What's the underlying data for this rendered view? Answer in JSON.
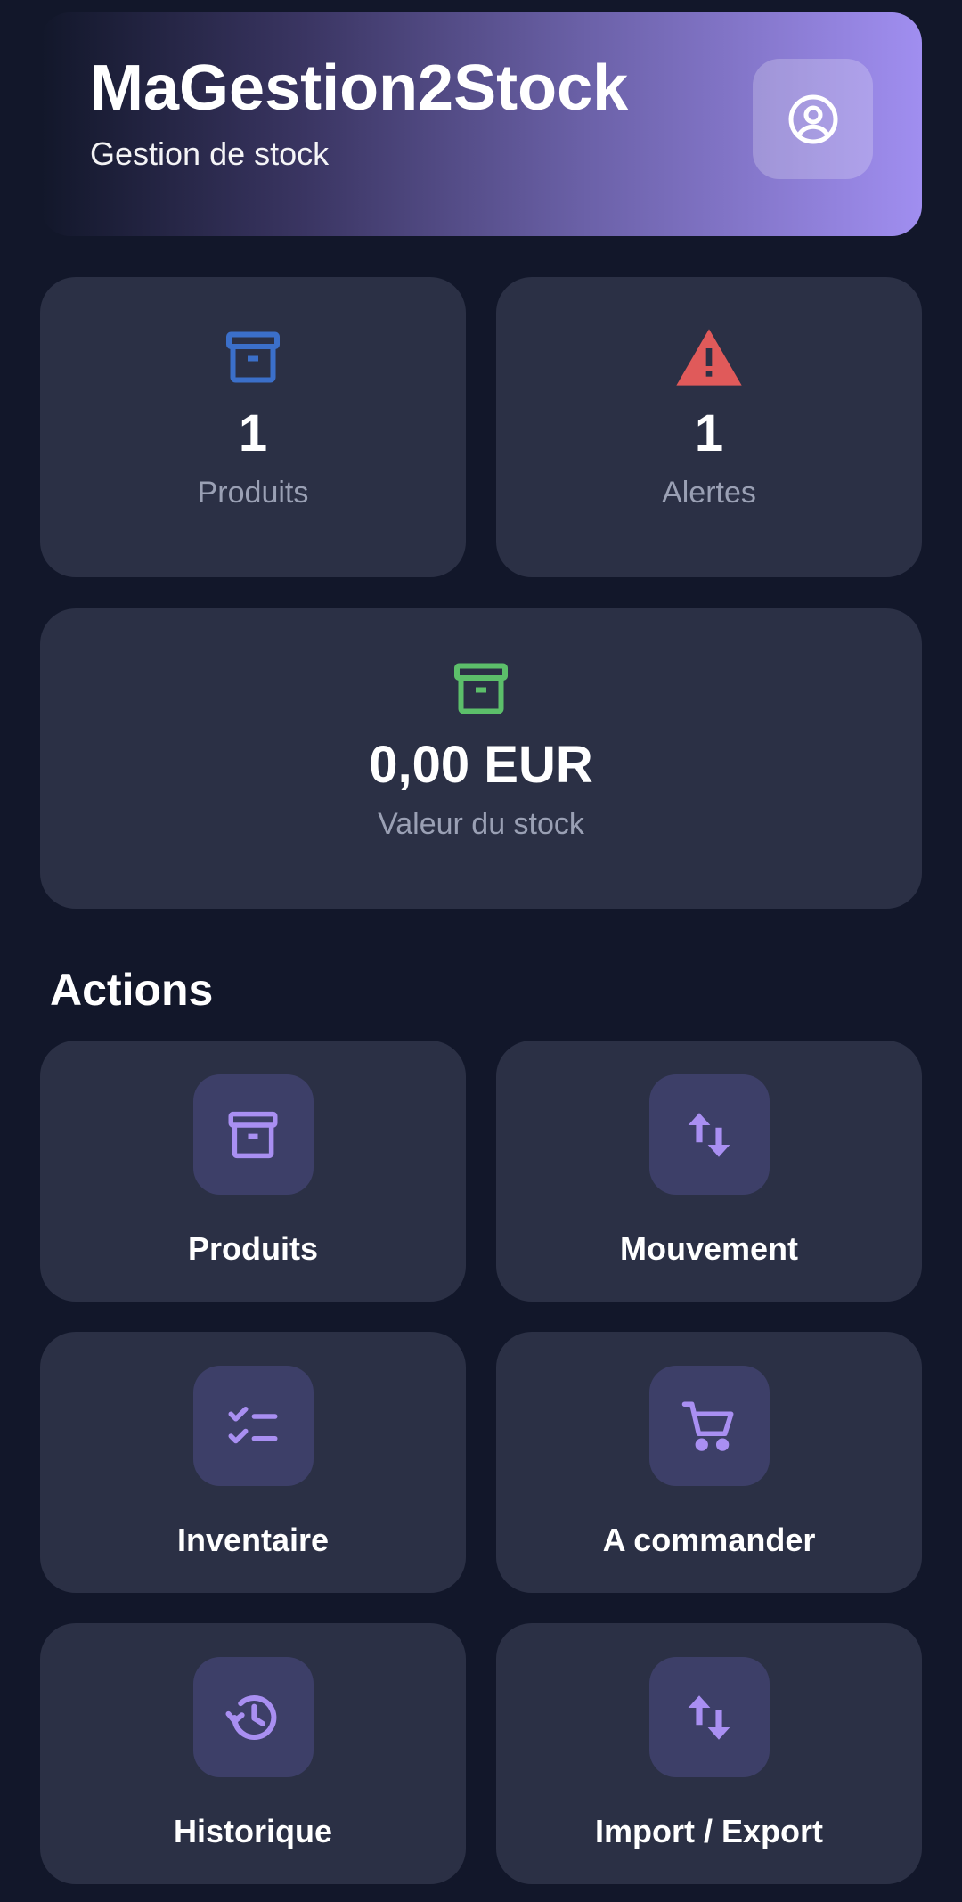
{
  "header": {
    "title": "MaGestion2Stock",
    "subtitle": "Gestion de stock",
    "profile_icon": "account-circle-icon"
  },
  "stats": [
    {
      "value": "1",
      "label": "Produits",
      "icon": "archive-icon",
      "color": "#3b6fc9"
    },
    {
      "value": "1",
      "label": "Alertes",
      "icon": "warning-icon",
      "color": "#e05a5a"
    },
    {
      "value": "0,00 EUR",
      "label": "Valeur du stock",
      "icon": "archive-icon",
      "color": "#5cbf6a"
    }
  ],
  "actions_title": "Actions",
  "actions": [
    {
      "label": "Produits",
      "icon": "archive-icon"
    },
    {
      "label": "Mouvement",
      "icon": "swap-vertical-icon"
    },
    {
      "label": "Inventaire",
      "icon": "checklist-icon"
    },
    {
      "label": "A commander",
      "icon": "cart-icon"
    },
    {
      "label": "Historique",
      "icon": "history-icon"
    },
    {
      "label": "Import / Export",
      "icon": "swap-vertical-icon"
    }
  ],
  "colors": {
    "background": "#12172a",
    "card": "#2b3045",
    "accent": "#a08ef0",
    "action_icon": "#a98ff2"
  }
}
